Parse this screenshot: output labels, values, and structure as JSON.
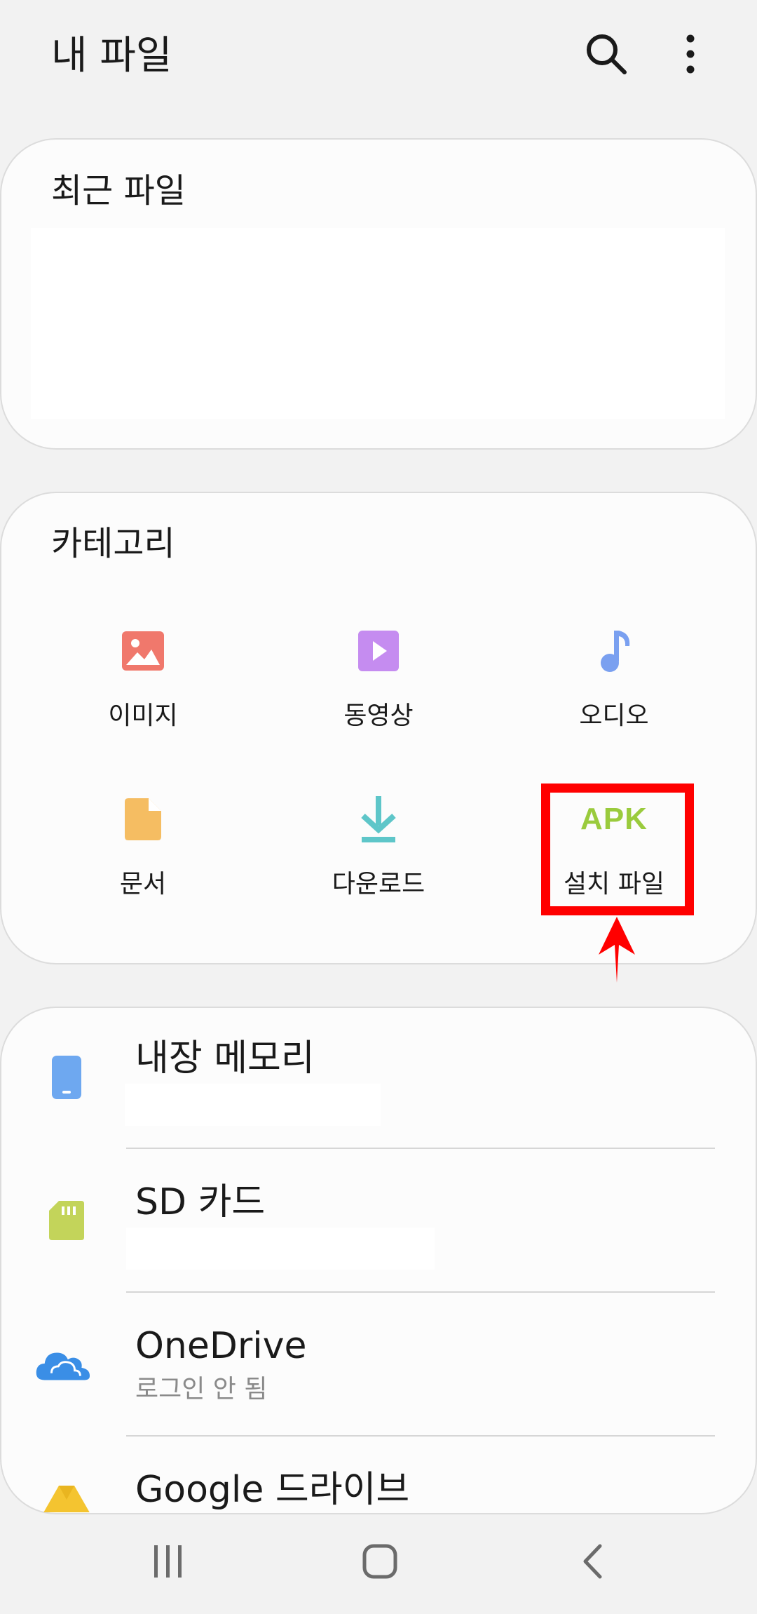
{
  "header": {
    "title": "내 파일",
    "search_icon": "search-icon",
    "more_icon": "more-vertical-icon"
  },
  "recent": {
    "title": "최근 파일"
  },
  "categories": {
    "title": "카테고리",
    "items": [
      {
        "label": "이미지",
        "icon": "image-icon",
        "color": "#f0786c"
      },
      {
        "label": "동영상",
        "icon": "video-icon",
        "color": "#c58cf0"
      },
      {
        "label": "오디오",
        "icon": "music-note-icon",
        "color": "#7aa0f0"
      },
      {
        "label": "문서",
        "icon": "document-icon",
        "color": "#f5bd62"
      },
      {
        "label": "다운로드",
        "icon": "download-icon",
        "color": "#5ec6c9"
      },
      {
        "label": "설치 파일",
        "icon": "apk-icon",
        "icon_text": "APK",
        "color": "#9acb3d"
      }
    ]
  },
  "storage": {
    "items": [
      {
        "title": "내장 메모리",
        "subtitle": "",
        "icon": "phone-icon",
        "color": "#6ea8f0"
      },
      {
        "title": "SD 카드",
        "subtitle": "",
        "icon": "sd-card-icon",
        "color": "#c3d45a"
      },
      {
        "title": "OneDrive",
        "subtitle": "로그인 안 됨",
        "icon": "onedrive-cloud-icon",
        "color": "#3a8ee6"
      },
      {
        "title": "Google 드라이브",
        "subtitle": "",
        "icon": "google-drive-icon",
        "color": "#f4c430"
      }
    ]
  },
  "annotation": {
    "highlight_color": "#ff0000"
  },
  "navbar": {
    "recents_icon": "recent-apps-icon",
    "home_icon": "home-icon",
    "back_icon": "back-icon"
  }
}
